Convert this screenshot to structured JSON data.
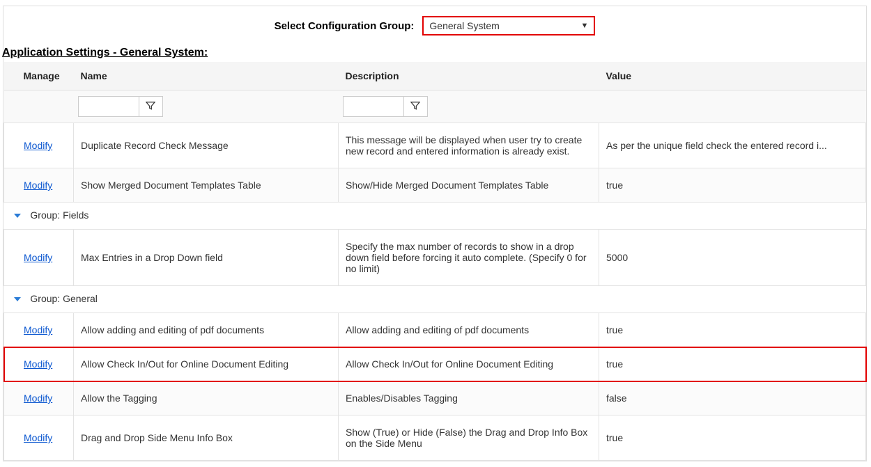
{
  "selector": {
    "label": "Select Configuration Group:",
    "value": "General System"
  },
  "section_title": "Application Settings - General System:",
  "columns": {
    "manage": "Manage",
    "name": "Name",
    "description": "Description",
    "value": "Value"
  },
  "modify_label": "Modify",
  "groups": {
    "fields": "Group: Fields",
    "general": "Group: General"
  },
  "rows": {
    "pre": [
      {
        "name": "Duplicate Record Check Message",
        "description": "This message will be displayed when user try to create new record and entered information is already exist.",
        "value": "As per the unique field check the entered record i..."
      },
      {
        "name": "Show Merged Document Templates Table",
        "description": "Show/Hide Merged Document Templates Table",
        "value": "true"
      }
    ],
    "fields": [
      {
        "name": "Max Entries in a Drop Down field",
        "description": "Specify the max number of records to show in a drop down field before forcing it auto complete. (Specify 0 for no limit)",
        "value": "5000"
      }
    ],
    "general": [
      {
        "name": "Allow adding and editing of pdf documents",
        "description": "Allow adding and editing of pdf documents",
        "value": "true"
      },
      {
        "name": "Allow Check In/Out for Online Document Editing",
        "description": "Allow Check In/Out for Online Document Editing",
        "value": "true"
      },
      {
        "name": "Allow the Tagging",
        "description": "Enables/Disables Tagging",
        "value": "false"
      },
      {
        "name": "Drag and Drop Side Menu Info Box",
        "description": "Show (True) or Hide (False) the Drag and Drop Info Box on the Side Menu",
        "value": "true"
      }
    ]
  },
  "highlighted_row_path": "rows.general.1"
}
